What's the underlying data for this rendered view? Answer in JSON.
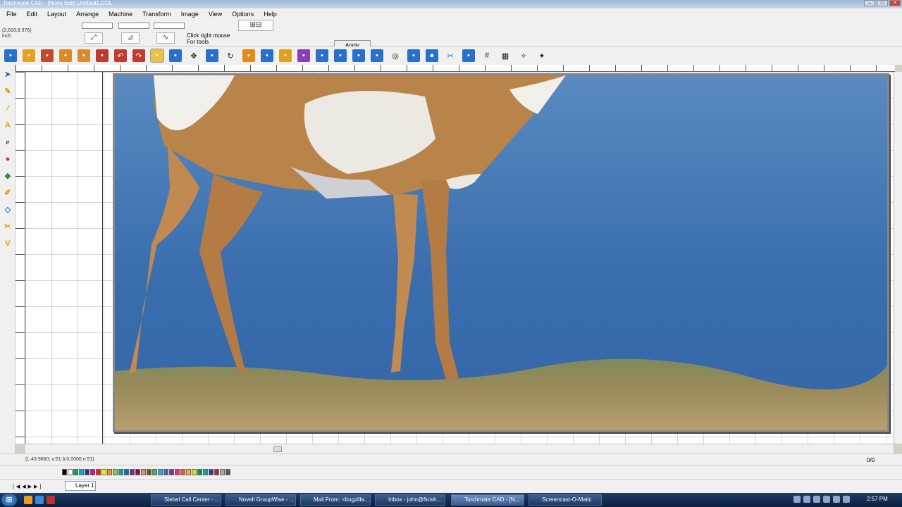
{
  "window": {
    "title": "Torchmate CAD - [Node Edit] Untitled1.CDL"
  },
  "menu": [
    "File",
    "Edit",
    "Layout",
    "Arrange",
    "Machine",
    "Transform",
    "Image",
    "View",
    "Options",
    "Help"
  ],
  "propbar": {
    "coords": "(2,818,8.976)",
    "unit": "inch",
    "hint_line1": "Click right mouse",
    "hint_line2": "For tools",
    "apply_label": "Apply"
  },
  "status": {
    "readout": "(L:43.9660; v:51 b:0.0000 n:51)",
    "count": "0/0"
  },
  "layer": {
    "name": "Layer 1"
  },
  "taskbar": {
    "tasks": [
      "Siebel Call Center - ...",
      "Novell GroupWise - ...",
      "Mail From: <bugzilla...",
      "Inbox - john@finish...",
      "Torchmate CAD - [N...",
      "Screencast-O-Matic"
    ],
    "clock": "2:57 PM"
  },
  "palette_colors": [
    "#000000",
    "#ffffff",
    "#00a651",
    "#00aeef",
    "#2e3192",
    "#ec008c",
    "#ed1c24",
    "#fff200",
    "#f7941d",
    "#8dc63f",
    "#00a99d",
    "#0072bc",
    "#662d91",
    "#9e005d",
    "#c69c6d",
    "#754c24",
    "#39b54a",
    "#27aae1",
    "#1c75bc",
    "#92278f",
    "#ee2a7b",
    "#f15a29",
    "#fbb040",
    "#d7df23",
    "#009444",
    "#00a79d",
    "#2b3990",
    "#be1e2d",
    "#a7a9ac",
    "#58595b"
  ]
}
